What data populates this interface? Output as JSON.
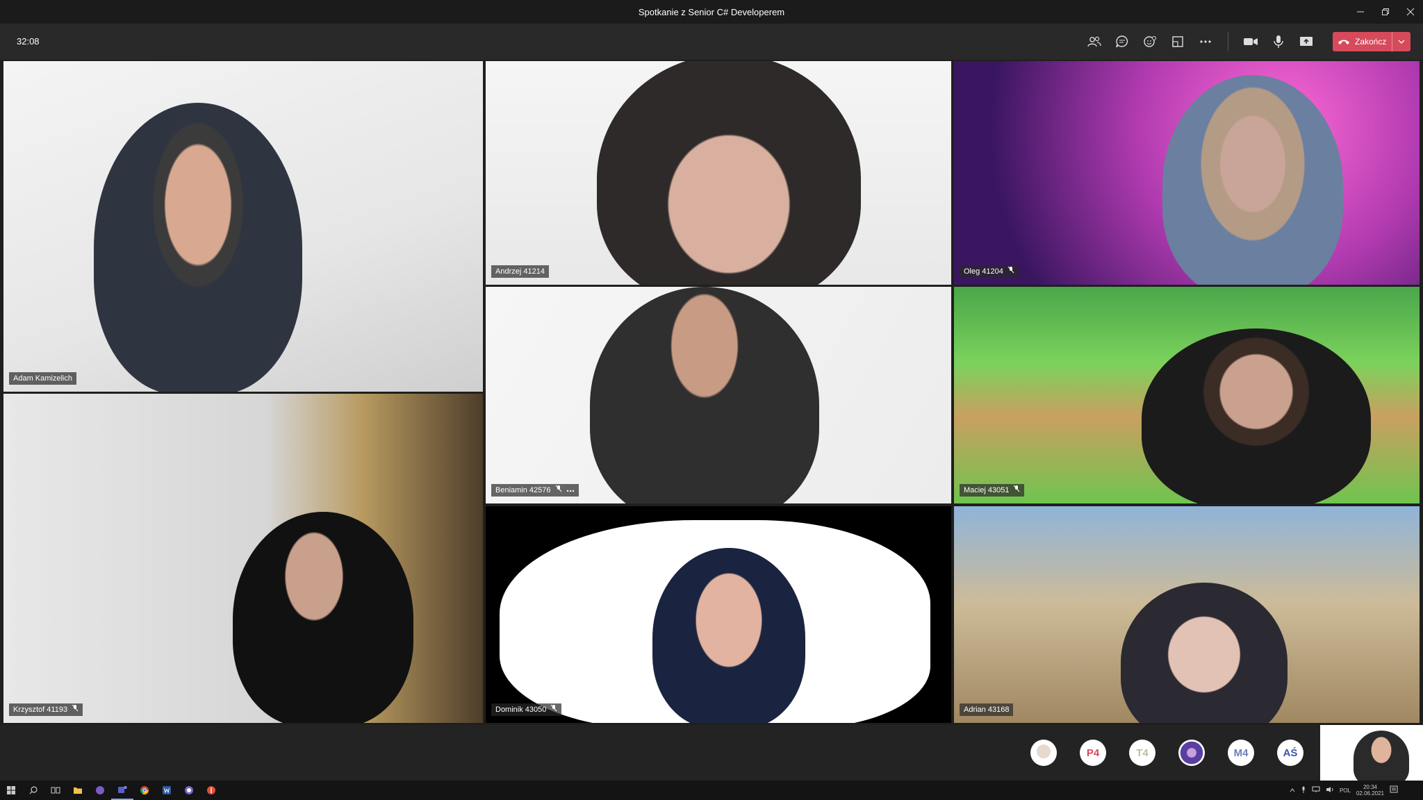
{
  "window": {
    "title": "Spotkanie z Senior C# Developerem",
    "minimize_icon": "minimize-icon",
    "maximize_icon": "restore-icon",
    "close_icon": "close-icon"
  },
  "toolbar": {
    "timer": "32:08",
    "end_call_label": "Zakończ",
    "accent_color": "#d64a5c"
  },
  "participants": [
    {
      "name": "Adam Kamizelich",
      "muted": false
    },
    {
      "name": "Andrzej 41214",
      "muted": false
    },
    {
      "name": "Oleg 41204",
      "muted": true
    },
    {
      "name": "Beniamin 42576",
      "muted": true
    },
    {
      "name": "Maciej 43051",
      "muted": true
    },
    {
      "name": "Krzysztof 41193",
      "muted": true
    },
    {
      "name": "Dominik 43050",
      "muted": true
    },
    {
      "name": "Adrian 43168",
      "muted": false
    }
  ],
  "roster": [
    {
      "initials": "",
      "kind": "photo"
    },
    {
      "initials": "P4",
      "color": "#d64a5c"
    },
    {
      "initials": "T4",
      "color": "#b7c2a0"
    },
    {
      "initials": "",
      "kind": "photo"
    },
    {
      "initials": "M4",
      "color": "#6f7fb8"
    },
    {
      "initials": "AŚ",
      "color": "#3f55a8"
    }
  ],
  "taskbar": {
    "language": "POL",
    "time": "20:34",
    "date": "02.06.2021"
  }
}
